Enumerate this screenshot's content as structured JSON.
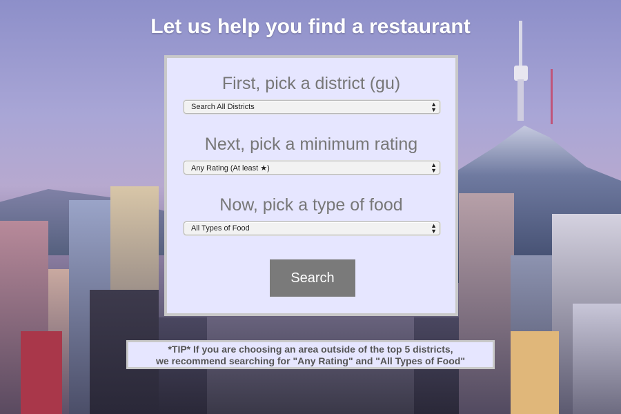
{
  "page": {
    "title": "Let us help you find a restaurant"
  },
  "form": {
    "district": {
      "label": "First, pick a district (gu)",
      "selected": "Search All Districts"
    },
    "rating": {
      "label": "Next, pick a minimum rating",
      "selected": "Any Rating (At least ★)"
    },
    "food": {
      "label": "Now, pick a type of food",
      "selected": "All Types of Food"
    },
    "search_label": "Search"
  },
  "tip": {
    "line1": "*TIP* If you are choosing an area outside of the top 5 districts,",
    "line2": "we recommend searching for \"Any Rating\" and \"All Types of Food\""
  },
  "colors": {
    "panel_bg": "#e6e6ff",
    "panel_border": "#c9c9c9",
    "button_bg": "#7a7a7a",
    "label_text": "#777777"
  }
}
